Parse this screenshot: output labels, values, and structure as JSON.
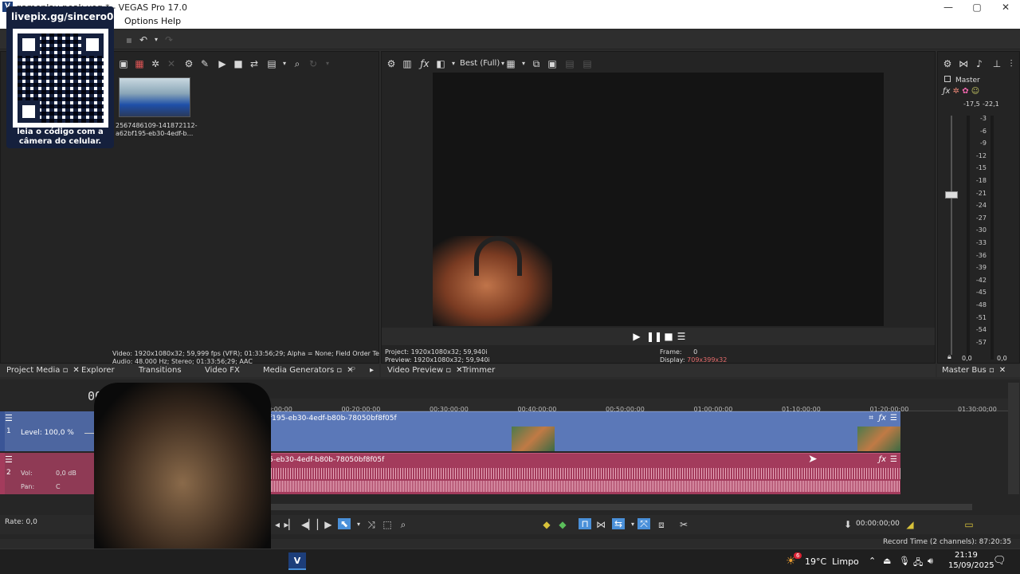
{
  "window": {
    "title": "gameplay peak.veg * - VEGAS Pro 17.0",
    "min": "—",
    "max": "▢",
    "close": "✕"
  },
  "menu": {
    "options": "Options",
    "help": "Help"
  },
  "qr_overlay": {
    "url": "livepix.gg/sincero0o",
    "caption_line1": "leia o código com a",
    "caption_line2": "câmera do celular."
  },
  "media": {
    "thumb_name": "2567486109-141872112-a62bf195-eb30-4edf-b..."
  },
  "media_info": {
    "line1": "Video: 1920x1080x32; 59,999 fps (VFR); 01:33:56;29; Alpha = None; Field Order Test",
    "line2": "Audio: 48.000 Hz; Stereo; 01:33:56;29; AAC"
  },
  "left_tabs": {
    "project_media": "Project Media",
    "explorer": "Explorer",
    "transitions": "Transitions",
    "video_fx": "Video FX",
    "media_generators": "Media Generators",
    "extra": "P"
  },
  "preview": {
    "quality": "Best (Full)",
    "project_label": "Project:",
    "project_value": "1920x1080x32; 59,940i",
    "preview_label": "Preview:",
    "preview_value": "1920x1080x32; 59,940i",
    "frame_label": "Frame:",
    "frame_value": "0",
    "display_label": "Display:",
    "display_value": "709x399x32",
    "tab_video_preview": "Video Preview",
    "tab_trimmer": "Trimmer"
  },
  "master": {
    "label": "Master",
    "peak_l": "-17,5",
    "peak_r": "-22,1",
    "scale": [
      "3",
      "6",
      "9",
      "12",
      "15",
      "18",
      "21",
      "24",
      "27",
      "30",
      "33",
      "36",
      "39",
      "42",
      "45",
      "48",
      "51",
      "54",
      "57"
    ],
    "fader_l": "0,0",
    "fader_r": "0,0",
    "tab": "Master Bus"
  },
  "timeline": {
    "timecode": "00:00:0",
    "ruler": [
      "00:10:00;00",
      "00:20:00;00",
      "00:30:00;00",
      "00:40:00;00",
      "00:50:00;00",
      "01:00:00;00",
      "01:10:00;00",
      "01:20:00;00",
      "01:30:00;00"
    ],
    "video_track": {
      "number": "1",
      "level_label": "Level: 100,0 %",
      "clip_name": "1872112-a62bf195-eb30-4edf-b80b-78050bf8f05f"
    },
    "audio_track": {
      "number": "2",
      "vol_label": "Vol:",
      "vol_value": "0,0 dB",
      "pan_label": "Pan:",
      "pan_value": "C",
      "clip_name": "a62bf195-eb30-4edf-b80b-78050bf8f05f"
    },
    "rate": "Rate: 0,0",
    "cursor_time": "00:00:00;00",
    "record_time": "Record Time (2 channels): 87:20:35"
  },
  "taskbar": {
    "weather": "19°C  Limpo",
    "time": "21:19",
    "date": "15/09/2025",
    "notif_count": "6"
  },
  "colors": {
    "video_track": "#5b78b8",
    "audio_track": "#a33b5c",
    "waveform": "#f2b7c8",
    "accent": "#4a90d9"
  }
}
